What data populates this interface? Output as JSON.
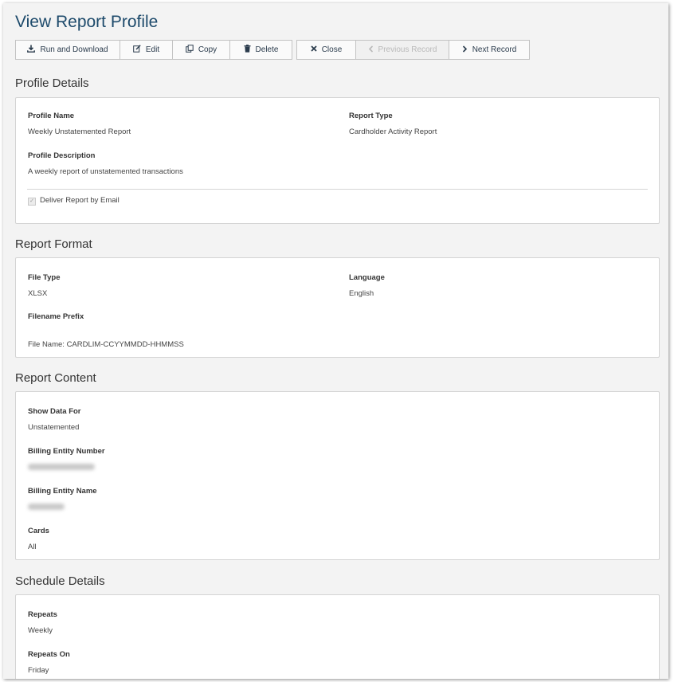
{
  "page": {
    "title": "View Report Profile"
  },
  "toolbar": {
    "run_download": "Run and Download",
    "edit": "Edit",
    "copy": "Copy",
    "delete": "Delete",
    "close": "Close",
    "previous_record": "Previous Record",
    "next_record": "Next Record"
  },
  "profile_details": {
    "heading": "Profile Details",
    "profile_name_label": "Profile Name",
    "profile_name": "Weekly Unstatemented Report",
    "report_type_label": "Report Type",
    "report_type": "Cardholder Activity Report",
    "description_label": "Profile Description",
    "description": "A weekly report of unstatemented transactions",
    "deliver_email_label": "Deliver Report by Email",
    "deliver_email_checked": true
  },
  "report_format": {
    "heading": "Report Format",
    "file_type_label": "File Type",
    "file_type": "XLSX",
    "language_label": "Language",
    "language": "English",
    "filename_prefix_label": "Filename Prefix",
    "file_name": "File Name: CARDLIM-CCYYMMDD-HHMMSS"
  },
  "report_content": {
    "heading": "Report Content",
    "show_data_for_label": "Show Data For",
    "show_data_for": "Unstatemented",
    "billing_entity_number_label": "Billing Entity Number",
    "billing_entity_name_label": "Billing Entity Name",
    "cards_label": "Cards",
    "cards": "All"
  },
  "schedule_details": {
    "heading": "Schedule Details",
    "repeats_label": "Repeats",
    "repeats": "Weekly",
    "repeats_on_label": "Repeats On",
    "repeats_on": "Friday"
  }
}
